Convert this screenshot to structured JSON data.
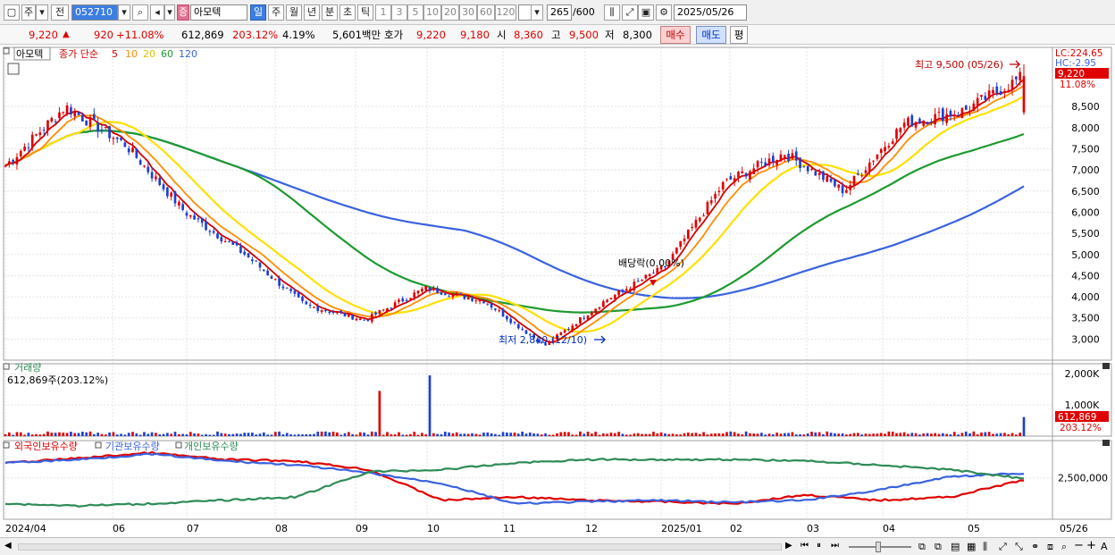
{
  "toolbar": {
    "type_label": "주",
    "scope_label": "전",
    "code": "052710",
    "market_badge": "증",
    "stock_name": "아모텍",
    "periods": [
      "일",
      "주",
      "월",
      "년",
      "분",
      "초",
      "틱"
    ],
    "selected_period": "일",
    "intervals": [
      "1",
      "3",
      "5",
      "10",
      "20",
      "30",
      "60",
      "120"
    ],
    "count_value": "265",
    "count_total": "/600",
    "date": "2025/05/26"
  },
  "quote": {
    "price": "9,220",
    "change": "920",
    "change_pct": "+11.08%",
    "volume": "612,869",
    "volume_ratio": "203.12%",
    "turnover": "4.19%",
    "amount": "5,601백만",
    "bid_label": "호가",
    "ask_price": "9,220",
    "bid_price": "9,180",
    "open_label": "시",
    "open": "8,360",
    "high_label": "고",
    "high": "9,500",
    "low_label": "저",
    "low": "8,300",
    "buy_label": "매수",
    "sell_label": "매도",
    "avg_label": "평"
  },
  "colors": {
    "up": "#e00000",
    "down": "#1c40d0",
    "ma5": "#d40000",
    "ma10": "#ff8c00",
    "ma20": "#ffe000",
    "ma60": "#1e9a30",
    "ma120": "#3a62e0",
    "foreign": "#e00000",
    "institution": "#3a62e0",
    "individual": "#2e8b57"
  },
  "chart_data": [
    {
      "type": "candlestick",
      "panel": "price",
      "legend": {
        "name": "아모텍",
        "ma_label": "종가 단순",
        "ma_periods": [
          "5",
          "10",
          "20",
          "60",
          "120"
        ]
      },
      "ylim": [
        2500,
        9900
      ],
      "y_ticks": [
        "3,000",
        "3,500",
        "4,000",
        "4,500",
        "5,000",
        "5,500",
        "6,000",
        "6,500",
        "7,000",
        "7,500",
        "8,000",
        "8,500"
      ],
      "y_tick_values": [
        3000,
        3500,
        4000,
        4500,
        5000,
        5500,
        6000,
        6500,
        7000,
        7500,
        8000,
        8500
      ],
      "lc_label": "LC:224.65",
      "hc_label": "HC:-2.95",
      "last_price_label": "9,220",
      "last_pct_label": "11.08%",
      "high_annotation": "최고 9,500 (05/26)",
      "low_annotation": "최저 2,840 (12/10)",
      "dividend_annotation": "배당락(0.00%)",
      "key_points": [
        {
          "date": "2024/04",
          "close": 7100
        },
        {
          "date": "2024/04-mid",
          "close": 8500
        },
        {
          "date": "2024/06",
          "close": 7600
        },
        {
          "date": "2024/07",
          "close": 6000
        },
        {
          "date": "2024/08",
          "close": 5000
        },
        {
          "date": "2024/09",
          "close": 3800
        },
        {
          "date": "2024/10",
          "close": 3450
        },
        {
          "date": "2024/10-end",
          "close": 4200
        },
        {
          "date": "2024/11",
          "close": 3900
        },
        {
          "date": "2024/12/10",
          "close": 2840
        },
        {
          "date": "2025/01",
          "close": 3900
        },
        {
          "date": "2025/02",
          "close": 4700
        },
        {
          "date": "2025/03",
          "close": 6700
        },
        {
          "date": "2025/03-mid",
          "close": 7400
        },
        {
          "date": "2025/04",
          "close": 6500
        },
        {
          "date": "2025/04-end",
          "close": 8100
        },
        {
          "date": "2025/05",
          "close": 8400
        },
        {
          "date": "2025/05/26",
          "close": 9220
        }
      ],
      "ma60_end": 7400,
      "ma120_end": 5800
    },
    {
      "type": "bar",
      "panel": "volume",
      "title": "거래량",
      "subtitle": "612,869주(203.12%)",
      "y_ticks": [
        "1,000K",
        "2,000K"
      ],
      "y_tick_values": [
        1000000,
        2000000
      ],
      "last_volume_label": "612,869",
      "last_ratio_label": "203.12%",
      "spikes": [
        {
          "date": "2024/10",
          "volume": 1450000
        },
        {
          "date": "2024/10-end",
          "volume": 1950000
        },
        {
          "date": "2025/05/26",
          "volume": 612869
        }
      ]
    },
    {
      "type": "line",
      "panel": "holdings",
      "legend": [
        "외국인보유수량",
        "기관보유수량",
        "개인보유수량"
      ],
      "y_ticks": [
        "2,500,000"
      ],
      "y_tick_values": [
        2500000
      ]
    }
  ],
  "x_axis": {
    "labels": [
      "2024/04",
      "06",
      "07",
      "08",
      "09",
      "10",
      "11",
      "12",
      "2025/01",
      "02",
      "03",
      "04",
      "05"
    ],
    "end_label": "05/26"
  },
  "bottom": {
    "zoom_minus": "−",
    "zoom_plus": "+",
    "font_a": "A"
  }
}
